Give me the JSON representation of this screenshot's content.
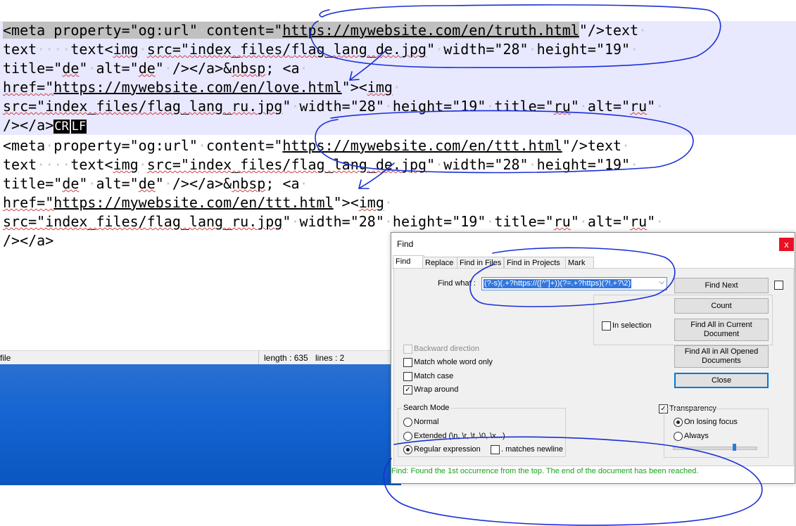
{
  "editor": {
    "l1": {
      "a": "<meta",
      "b": "property=\"og:url\"",
      "c": "content=\"",
      "d": "https://mywebsite.com/en/truth.html",
      "e": "\"/>text",
      "f": "text",
      "g": "text<",
      "h": "img",
      "i": "src=\"index_files/",
      "j": "flag_lang_de.jpg",
      "k": "\"",
      "l": "width=\"28\"",
      "m": "height=\"19\"",
      "n": "title=\"",
      "o": "de",
      "p": "\"",
      "q": "alt=\"",
      "r": "de",
      "s": "\"",
      "t": "/></a>&",
      "u": "nbsp",
      "v": "; <a",
      "w": "href=\"",
      "x": "https://mywebsite.com/en/love.html",
      "y": "\"><",
      "z": "img",
      "aa": "src=\"index_files/",
      "ab": "flag_lang_ru.jpg",
      "ac": "\"",
      "ad": "width=\"28\"",
      "ae": "height=\"19\"",
      "af": "title=\"",
      "ag": "ru",
      "ah": "\"",
      "ai": "alt=\"",
      "aj": "ru",
      "ak": "\"",
      "al": "/></a>",
      "cr": "CR",
      "lf": "LF"
    },
    "l2": {
      "a": "<meta",
      "b": "property=\"og:url\"",
      "c": "content=\"",
      "d": "https://mywebsite.com/en/ttt.html",
      "e": "\"/>text",
      "f": "text",
      "g": "text<",
      "h": "img",
      "i": "src=\"index_files/",
      "j": "flag_lang_de.jpg",
      "k": "\"",
      "l": "width=\"28\"",
      "m": "height=\"19\"",
      "n": "title=\"",
      "o": "de",
      "p": "\"",
      "q": "alt=\"",
      "r": "de",
      "s": "\"",
      "t": "/></a>&",
      "u": "nbsp",
      "v": "; <a",
      "w": "href=\"",
      "x": "https://mywebsite.com/en/ttt.html",
      "y": "\"><",
      "z": "img",
      "aa": "src=\"index_files/",
      "ab": "flag_lang_ru.jpg",
      "ac": "\"",
      "ad": "width=\"28\"",
      "ae": "height=\"19\"",
      "af": "title=\"",
      "ag": "ru",
      "ah": "\"",
      "ai": "alt=\"",
      "aj": "ru",
      "ak": "\"",
      "al": "/></a>"
    }
  },
  "statusbar": {
    "type": "file",
    "length": "length : 635",
    "lines": "lines : 2"
  },
  "dialog": {
    "title": "Find",
    "close_glyph": "x",
    "tabs": [
      "Find",
      "Replace",
      "Find in Files",
      "Find in Projects",
      "Mark"
    ],
    "find_what_label": "Find what :",
    "find_what_value": "(?-s)(.+?https://([^\"]+))(?=.+?https)(?!.+?\\2)",
    "combo_arrow": "⌵",
    "buttons": {
      "find_next": "Find Next",
      "count": "Count",
      "find_all_current_1": "Find All in Current",
      "find_all_current_2": "Document",
      "find_all_opened_1": "Find All in All Opened",
      "find_all_opened_2": "Documents",
      "close": "Close"
    },
    "in_selection": "In selection",
    "options": {
      "backward": "Backward direction",
      "whole_word": "Match whole word only",
      "match_case": "Match case",
      "wrap_around": "Wrap around",
      "check_glyph": "✓"
    },
    "search_mode": {
      "label": "Search Mode",
      "normal": "Normal",
      "extended": "Extended (\\n, \\r, \\t, \\0, \\x...)",
      "regex": "Regular expression",
      "matches_newline": ". matches newline",
      "selected": "Regular expression"
    },
    "transparency": {
      "label": "Transparency",
      "on_losing_focus": "On losing focus",
      "always": "Always",
      "selected": "On losing focus"
    },
    "status_message": "Find: Found the 1st occurrence from the top. The end of the document has been reached."
  },
  "colors": {
    "annotation_ink": "#1a2fd6",
    "status_green": "#1aa11a",
    "selected_line_bg": "#e8e8ff",
    "close_red": "#e81123"
  }
}
